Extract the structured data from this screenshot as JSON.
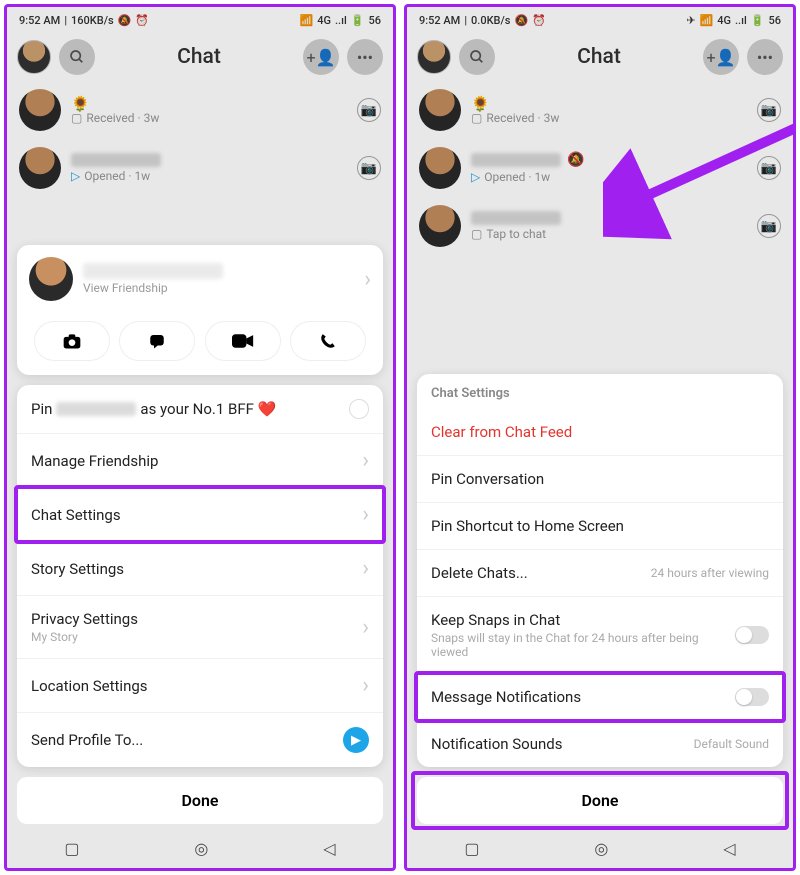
{
  "status": {
    "time": "9:52 AM",
    "speed_left": "160KB/s",
    "speed_right": "0.0KB/s",
    "vibrate": "✵",
    "alarm": "⏰",
    "net": "4G",
    "batt": "56"
  },
  "header": {
    "title": "Chat"
  },
  "chats": {
    "row1": {
      "emoji": "🌻",
      "sub_icon": "▢",
      "sub": "Received · 3w"
    },
    "row2": {
      "sub_icon": "▷",
      "sub": "Opened · 1w"
    },
    "row3": {
      "sub_icon": "▢",
      "sub": "Tap to chat"
    }
  },
  "profile": {
    "view": "View Friendship"
  },
  "menu": {
    "pin_pre": "Pin",
    "pin_post": "as your No.1 BFF ❤️",
    "manage": "Manage Friendship",
    "chat_settings": "Chat Settings",
    "story": "Story Settings",
    "privacy": "Privacy Settings",
    "privacy_sub": "My Story",
    "location": "Location Settings",
    "send": "Send Profile To..."
  },
  "chat_settings": {
    "title": "Chat Settings",
    "clear": "Clear from Chat Feed",
    "pin_conv": "Pin Conversation",
    "pin_home": "Pin Shortcut to Home Screen",
    "delete": "Delete Chats...",
    "delete_sub": "24 hours after viewing",
    "keep": "Keep Snaps in Chat",
    "keep_sub": "Snaps will stay in the Chat for 24 hours after being viewed",
    "msg_notif": "Message Notifications",
    "notif_sounds": "Notification Sounds",
    "notif_sounds_sub": "Default Sound"
  },
  "done": "Done"
}
